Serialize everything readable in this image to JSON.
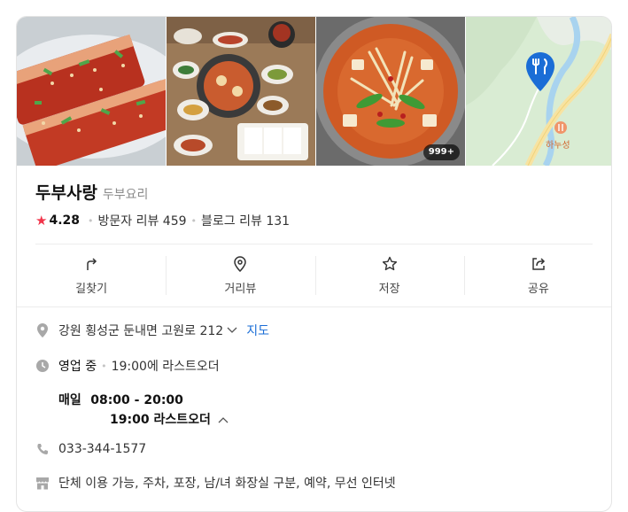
{
  "photos": {
    "count_badge": "999+",
    "map_pin_label": "하누성"
  },
  "place": {
    "name": "두부사랑",
    "category": "두부요리",
    "rating": "4.28",
    "visitor_reviews": "방문자 리뷰 459",
    "blog_reviews": "블로그 리뷰 131"
  },
  "actions": [
    {
      "label": "길찾기",
      "icon": "directions-icon"
    },
    {
      "label": "거리뷰",
      "icon": "street-view-icon"
    },
    {
      "label": "저장",
      "icon": "star-outline-icon"
    },
    {
      "label": "공유",
      "icon": "share-icon"
    }
  ],
  "info": {
    "address": "강원 횡성군 둔내면 고원로 212",
    "map_link": "지도",
    "status": "영업 중",
    "last_order_note": "19:00에 라스트오더",
    "hours_day": "매일",
    "hours_time": "08:00 - 20:00",
    "hours_last_order": "19:00 라스트오더",
    "phone": "033-344-1577",
    "amenities": "단체 이용 가능, 주차, 포장, 남/녀 화장실 구분, 예약, 무선 인터넷"
  },
  "colors": {
    "star": "#f1344a",
    "link": "#1a6dd6",
    "map_pin": "#1a6dd6"
  }
}
